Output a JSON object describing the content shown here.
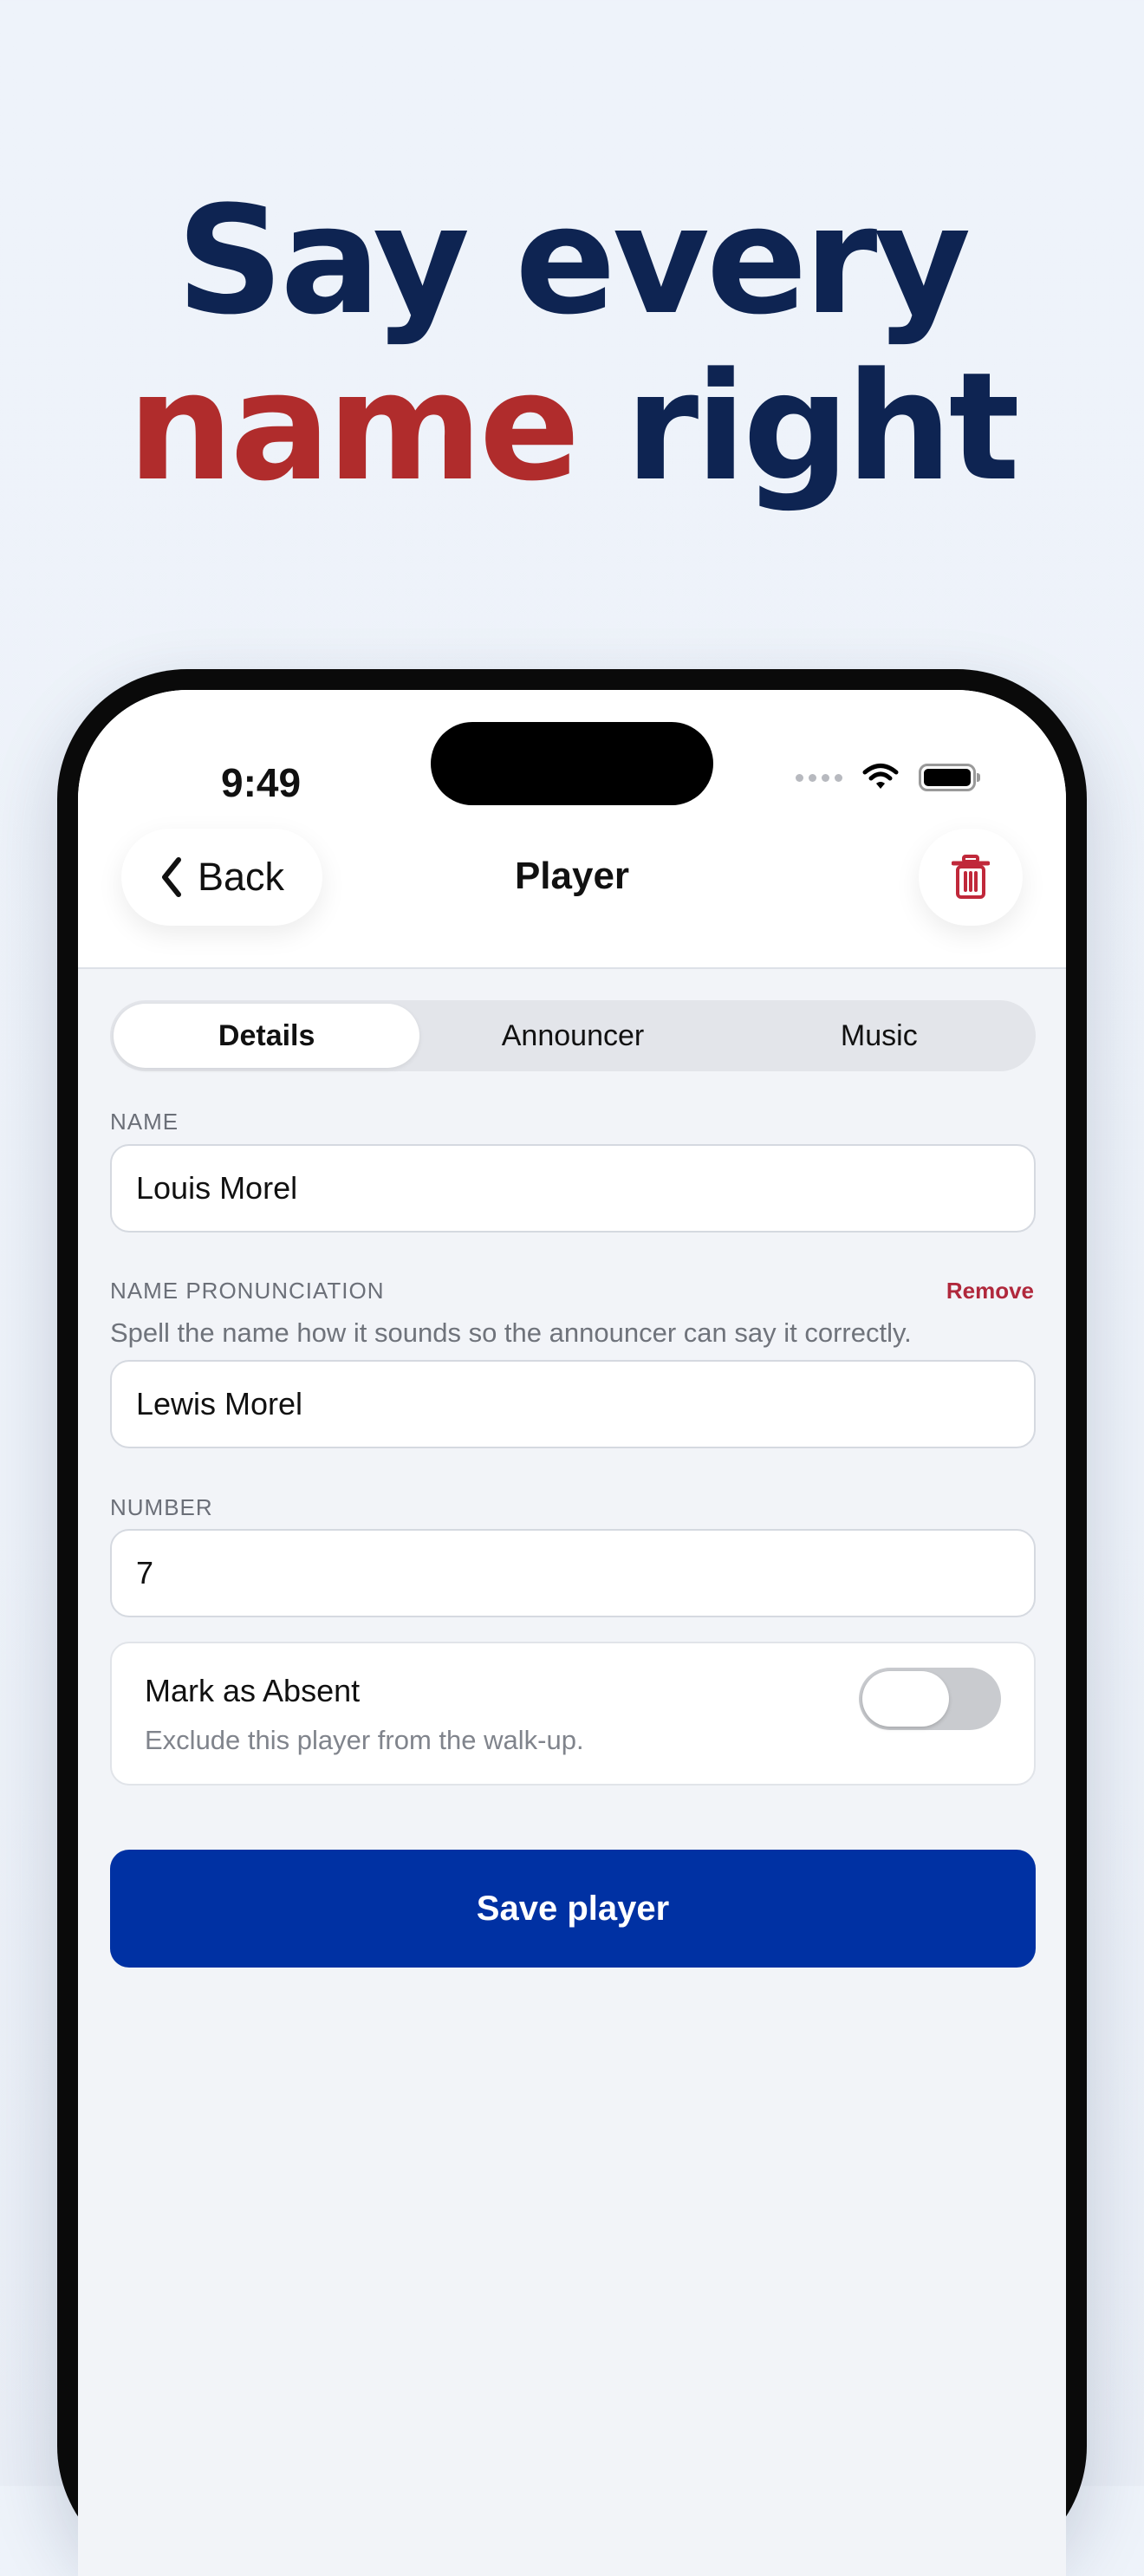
{
  "headline": {
    "line1": "Say every",
    "accent_word": "name",
    "line2_rest": " right"
  },
  "status_bar": {
    "time": "9:49",
    "icons": [
      "cellular-dots-icon",
      "wifi-icon",
      "battery-icon"
    ]
  },
  "nav": {
    "back_label": "Back",
    "title": "Player",
    "delete_icon": "trash-icon"
  },
  "tabs": [
    {
      "label": "Details",
      "active": true
    },
    {
      "label": "Announcer",
      "active": false
    },
    {
      "label": "Music",
      "active": false
    }
  ],
  "form": {
    "name": {
      "label": "NAME",
      "value": "Louis Morel"
    },
    "pronunciation": {
      "label": "NAME PRONUNCIATION",
      "remove_label": "Remove",
      "hint": "Spell the name how it sounds so the announcer can say it correctly.",
      "value": "Lewis Morel"
    },
    "number": {
      "label": "NUMBER",
      "value": "7"
    },
    "absent": {
      "title": "Mark as Absent",
      "subtitle": "Exclude this player from the walk-up.",
      "enabled": false
    },
    "save_label": "Save player"
  },
  "colors": {
    "headline": "#0e2452",
    "accent": "#b02c2c",
    "primary_button": "#0031a3",
    "danger": "#b0283c"
  }
}
